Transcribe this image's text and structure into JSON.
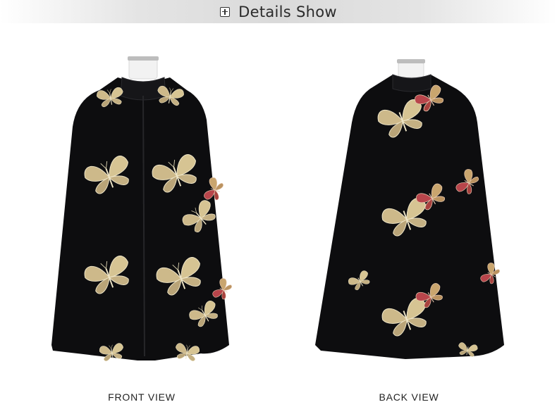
{
  "header": {
    "icon": "plus-square-icon",
    "title": "Details Show"
  },
  "views": {
    "front": {
      "label": "FRONT VIEW"
    },
    "back": {
      "label": "BACK VIEW"
    }
  },
  "colors": {
    "garment": "#0d0d0f",
    "embroidery_gold": "#cdb98a",
    "embroidery_red": "#b8454b"
  }
}
